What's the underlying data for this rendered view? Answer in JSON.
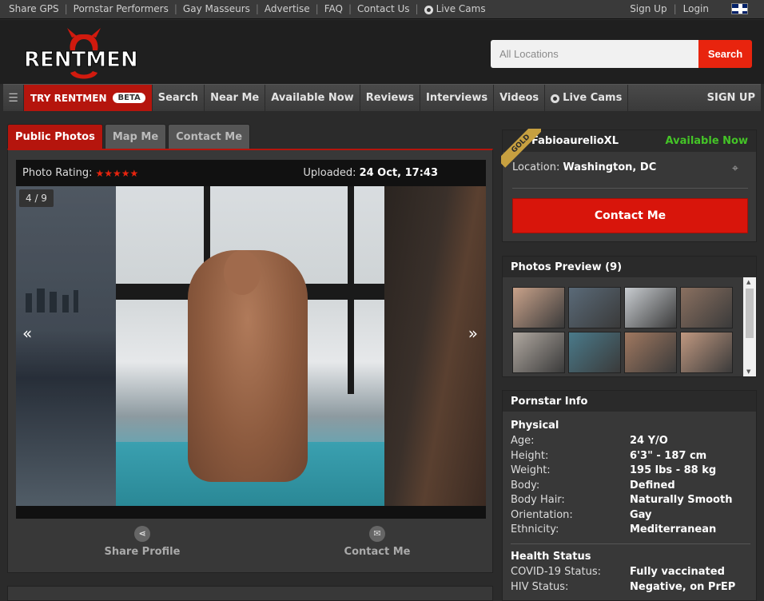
{
  "topbar": {
    "links": [
      "Share GPS",
      "Pornstar Performers",
      "Gay Masseurs",
      "Advertise",
      "FAQ",
      "Contact Us",
      "Live Cams"
    ],
    "sign_up": "Sign Up",
    "login": "Login",
    "flag_icon": "uk-flag-icon"
  },
  "header": {
    "logo_text": "RENTMEN",
    "search_placeholder": "All Locations",
    "search_button": "Search"
  },
  "nav": {
    "try_label": "TRY RENTMEN",
    "beta_label": "BETA",
    "items": [
      "Search",
      "Near Me",
      "Available Now",
      "Reviews",
      "Interviews",
      "Videos",
      "Live Cams"
    ],
    "sign_up": "SIGN UP"
  },
  "tabs": [
    "Public Photos",
    "Map Me",
    "Contact Me"
  ],
  "photo": {
    "rating_label": "Photo Rating:",
    "stars": "★★★★★",
    "uploaded_label": "Uploaded:",
    "uploaded_value": "24 Oct, 17:43",
    "counter": "4 / 9",
    "prev": "«",
    "next": "»"
  },
  "actions": {
    "share": "Share Profile",
    "contact": "Contact Me"
  },
  "profile": {
    "badge": "GOLD",
    "name": "FabioaurelioXL",
    "status": "Available Now",
    "location_label": "Location:",
    "location_value": "Washington, DC",
    "contact_button": "Contact Me"
  },
  "preview": {
    "title": "Photos Preview (9)",
    "thumb_colors": [
      "#c9a28a",
      "#5a6a78",
      "#c8ccd0",
      "#8a7060",
      "#b0a8a0",
      "#4a7a8a",
      "#a07860",
      "#c09880"
    ]
  },
  "info": {
    "title": "Pornstar Info",
    "physical_title": "Physical",
    "physical": [
      {
        "k": "Age:",
        "v": "24 Y/O"
      },
      {
        "k": "Height:",
        "v": "6'3\" - 187 cm"
      },
      {
        "k": "Weight:",
        "v": "195 lbs - 88 kg"
      },
      {
        "k": "Body:",
        "v": "Defined"
      },
      {
        "k": "Body Hair:",
        "v": "Naturally Smooth"
      },
      {
        "k": "Orientation:",
        "v": "Gay"
      },
      {
        "k": "Ethnicity:",
        "v": "Mediterranean"
      }
    ],
    "health_title": "Health Status",
    "health": [
      {
        "k": "COVID-19 Status:",
        "v": "Fully vaccinated"
      },
      {
        "k": "HIV Status:",
        "v": "Negative, on PrEP"
      }
    ]
  },
  "colors": {
    "accent_red": "#e8240e",
    "available_green": "#44c427",
    "gold": "#c7a040"
  }
}
